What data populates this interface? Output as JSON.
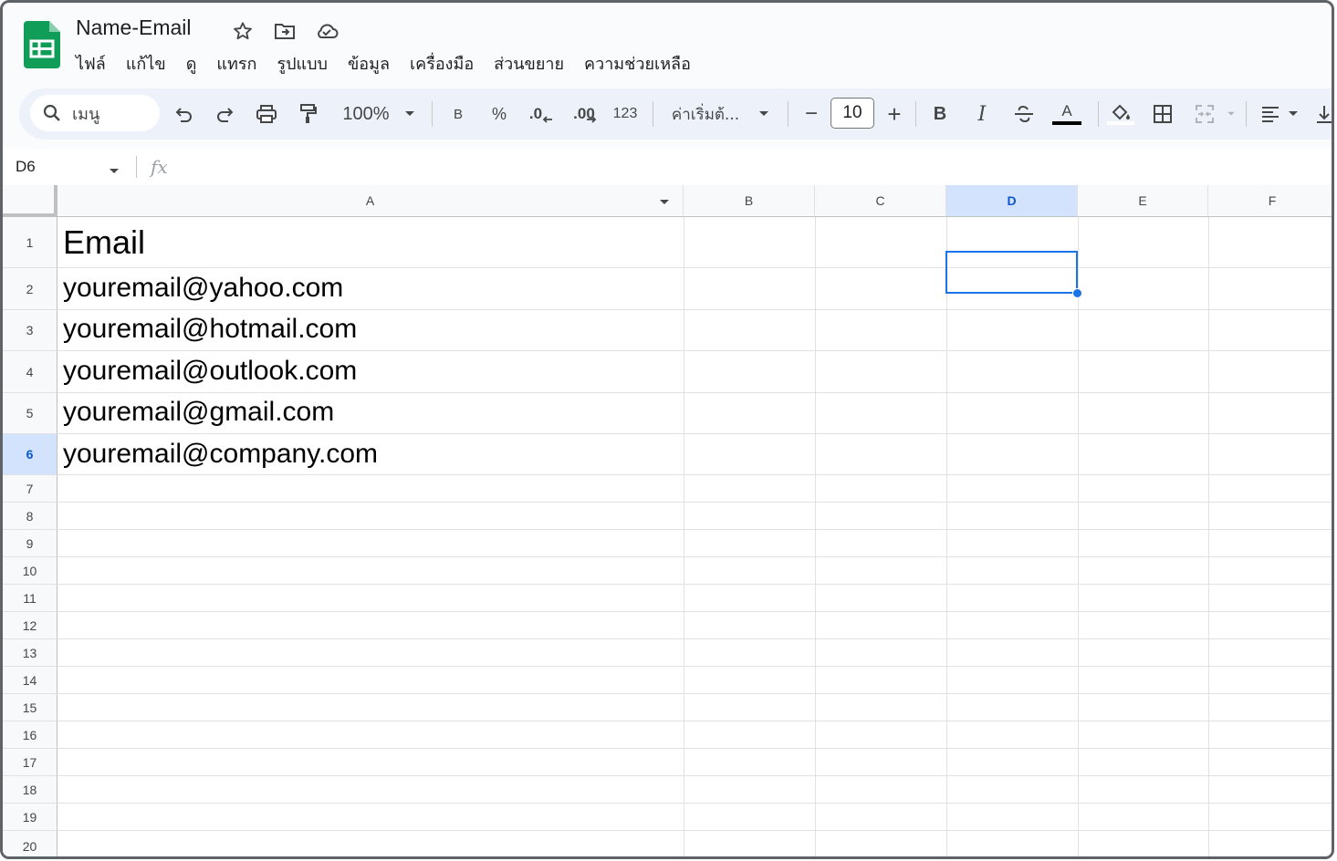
{
  "document": {
    "title": "Name-Email"
  },
  "menu": [
    "ไฟล์",
    "แก้ไข",
    "ดู",
    "แทรก",
    "รูปแบบ",
    "ข้อมูล",
    "เครื่องมือ",
    "ส่วนขยาย",
    "ความช่วยเหลือ"
  ],
  "toolbar": {
    "search_placeholder": "เมนู",
    "zoom": "100%",
    "percent": "%",
    "dec_decrease": ".0",
    "dec_increase": ".00",
    "number_format": "123",
    "font": "ค่าเริ่มต้...",
    "font_size": "10",
    "minus": "−",
    "plus": "+",
    "bold": "B",
    "italic": "I",
    "text_color_letter": "A",
    "currency": "B"
  },
  "formula_bar": {
    "name_box": "D6",
    "fx": "fx",
    "content": ""
  },
  "grid": {
    "columns": [
      "A",
      "B",
      "C",
      "D",
      "E",
      "F"
    ],
    "selected_column": "D",
    "rows": [
      "1",
      "2",
      "3",
      "4",
      "5",
      "6",
      "7",
      "8",
      "9",
      "10",
      "11",
      "12",
      "13",
      "14",
      "15",
      "16",
      "17",
      "18",
      "19",
      "20"
    ],
    "selected_row": "6",
    "cells": {
      "A1": "Email",
      "A2": "youremail@yahoo.com",
      "A3": "youremail@hotmail.com",
      "A4": "youremail@outlook.com",
      "A5": "youremail@gmail.com",
      "A6": "youremail@company.com"
    },
    "active_cell": "D6"
  },
  "colors": {
    "accent": "#1a73e8",
    "sheets_green": "#0f9d58",
    "toolbar_bg": "#edf2fa",
    "selected_header": "#d3e3fd"
  }
}
